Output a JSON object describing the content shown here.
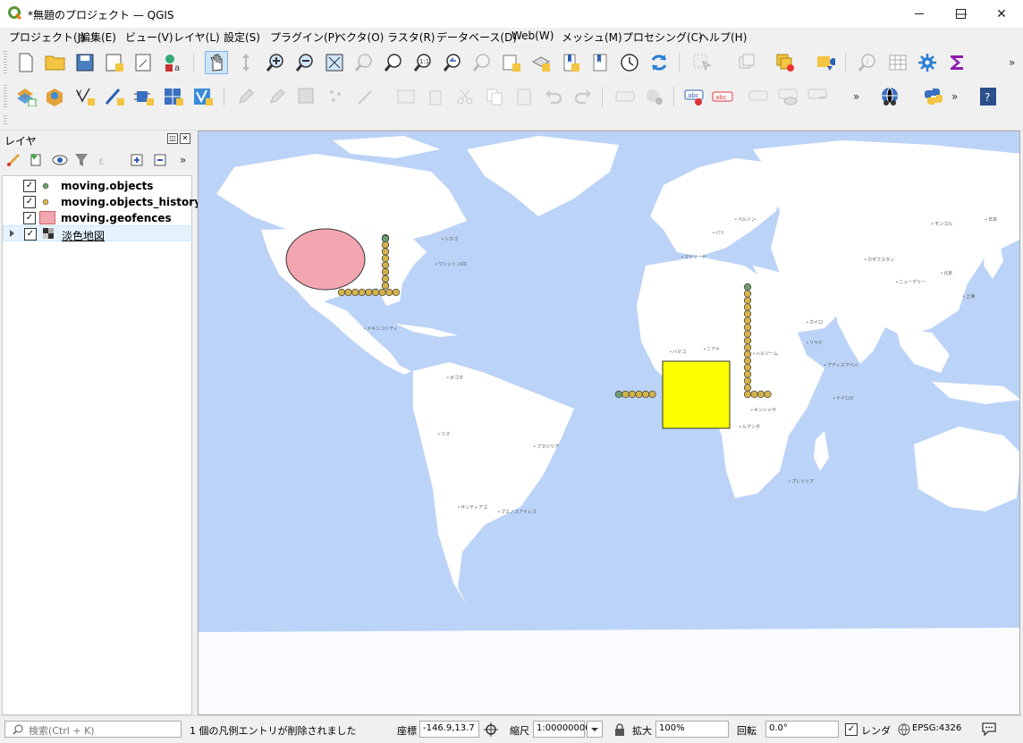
{
  "window": {
    "title": "*無題のプロジェクト — QGIS",
    "minimize": "—",
    "maximize": "☐",
    "close": "✕"
  },
  "menu": [
    "プロジェクト(J)",
    "編集(E)",
    "ビュー(V)",
    "レイヤ(L)",
    "設定(S)",
    "プラグイン(P)",
    "ベクタ(O)",
    "ラスタ(R)",
    "データベース(D)",
    "Web(W)",
    "メッシュ(M)",
    "プロセシング(C)",
    "ヘルプ(H)"
  ],
  "toolbar": {
    "overflow": "»"
  },
  "layers_panel": {
    "title": "レイヤ",
    "float_btn": "◫",
    "close_btn": "✕",
    "items": [
      {
        "label": "moving.objects",
        "checked": "✓",
        "symbol": "point-green"
      },
      {
        "label": "moving.objects_history",
        "checked": "✓",
        "symbol": "point-gold"
      },
      {
        "label": "moving.geofences",
        "checked": "✓",
        "symbol": "fill-pink"
      },
      {
        "label": "淡色地図",
        "checked": "✓",
        "symbol": "raster"
      }
    ]
  },
  "map": {
    "ocean_color": "#bcd3f8",
    "land_color": "#ffffff",
    "geofence_ellipse_color": "#f4a6b0",
    "geofence_square_color": "#ffff00",
    "history_point_color": "#d4b24c",
    "object_point_color": "#6e9e6e"
  },
  "status": {
    "search_placeholder": "検索(Ctrl + K)",
    "message": "1 個の凡例エントリが削除されました",
    "coord_label": "座標",
    "coord_value": "-146.9,13.7",
    "scale_label": "縮尺",
    "scale_value": "1:00000000",
    "magnifier_label": "拡大",
    "magnifier_value": "100%",
    "rotation_label": "回転",
    "rotation_value": "0.0°",
    "render_label": "レンダ",
    "render_checked": "✓",
    "crs": "EPSG:4326"
  }
}
